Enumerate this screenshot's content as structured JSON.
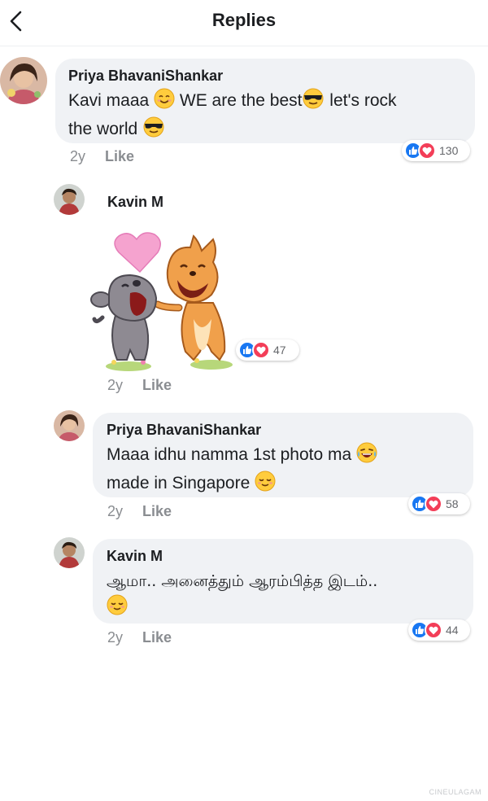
{
  "header": {
    "title": "Replies"
  },
  "comments": [
    {
      "name": "Priya BhavaniShankar",
      "line1_a": "Kavi maaa ",
      "line1_b": " WE are the best",
      "line1_c": " let's rock",
      "line2_a": "the world ",
      "time": "2y",
      "like_label": "Like",
      "reaction_count": "130"
    },
    {
      "name": "Kavin M",
      "sticker": "sticker-dog-hug-heart",
      "time": "2y",
      "like_label": "Like",
      "reaction_count": "47"
    },
    {
      "name": "Priya BhavaniShankar",
      "line1_a": "Maaa idhu namma 1st photo ma ",
      "line2_a": "made in Singapore ",
      "time": "2y",
      "like_label": "Like",
      "reaction_count": "58"
    },
    {
      "name": "Kavin M",
      "line1_a": "ஆமா.. அனைத்தும் ஆரம்பித்த இடம்..",
      "time": "2y",
      "like_label": "Like",
      "reaction_count": "44"
    }
  ],
  "watermark": "CINEULAGAM",
  "colors": {
    "bubble": "#f0f2f5",
    "like_blue": "#1877f2",
    "love_red": "#f33e58",
    "meta_gray": "#8a8d91"
  },
  "icons": [
    "back-chevron-icon",
    "like-reaction-icon",
    "love-reaction-icon",
    "smiling-emoji",
    "sunglasses-emoji",
    "laughing-tears-emoji",
    "relieved-emoji"
  ]
}
